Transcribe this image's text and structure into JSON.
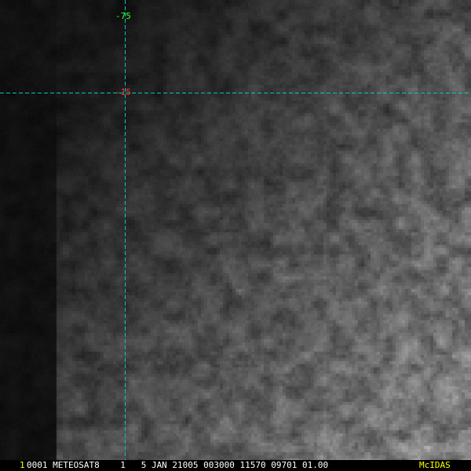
{
  "imagery": {
    "colors": {
      "background": "#000000",
      "dark_sky": "#1c1c1c",
      "cloud_mid": "#6e6e6e",
      "cloud_bright": "#d4d4d4"
    }
  },
  "grid": {
    "line_color": "#00c8c8",
    "labels": [
      {
        "text": "-75",
        "color": "#33ff33"
      },
      {
        "text": "-15",
        "color": "#ff3333"
      }
    ]
  },
  "status_bar": {
    "frame_number": "1",
    "frame_number_color": "#ffff00",
    "info": "0001 METEOSAT8    1   5 JAN 21005 003000 11570 09701 01.00",
    "info_color": "#ffffff",
    "brand": "McIDAS",
    "brand_color": "#ffff00"
  }
}
